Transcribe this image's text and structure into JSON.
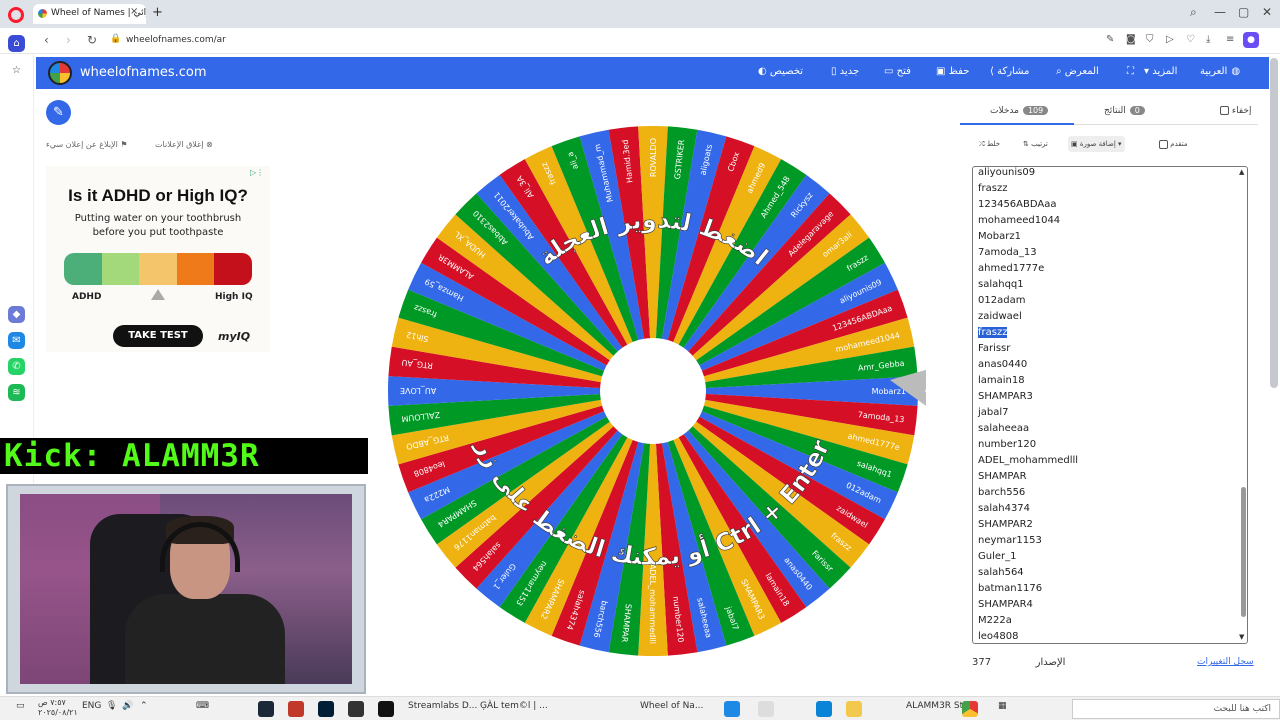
{
  "browser": {
    "tab_title": "Wheel of Names | عشوائي",
    "tab_close": "×",
    "new_tab": "+",
    "url": "wheelofnames.com/ar",
    "window_controls": [
      "—",
      "▢",
      "✕"
    ]
  },
  "site": {
    "name": "wheelofnames.com",
    "menu": [
      {
        "label": "العربية",
        "icon": "globe-icon"
      },
      {
        "label": "المزيد",
        "icon": "chevron-down-icon"
      },
      {
        "label": "",
        "icon": "fullscreen-icon"
      },
      {
        "label": "المعرض",
        "icon": "search-icon"
      },
      {
        "label": "مشاركة",
        "icon": "share-icon"
      },
      {
        "label": "حفظ",
        "icon": "save-icon"
      },
      {
        "label": "فتح",
        "icon": "folder-icon"
      },
      {
        "label": "جديد",
        "icon": "file-icon"
      },
      {
        "label": "تخصيص",
        "icon": "palette-icon"
      }
    ]
  },
  "left": {
    "report_ad": "الإبلاغ عن إعلان سيء",
    "close_ads": "إغلاق الإعلانات",
    "ad": {
      "title": "Is it ADHD or High IQ?",
      "subtitle": "Putting water on your toothbrush before you put toothpaste",
      "left_label": "ADHD",
      "right_label": "High IQ",
      "cta": "TAKE TEST",
      "brand": "myIQ",
      "bar_colors": [
        "#4caf7a",
        "#a3d97a",
        "#f4c56a",
        "#ee7a1a",
        "#c4101a"
      ]
    }
  },
  "stream": {
    "banner": "Kick: ALAMM3R"
  },
  "wheel": {
    "top_text": "اضغط لتدوير العجلة",
    "bottom_text": "أو يمكنك الضغط على زر Ctrl + Enter",
    "colors": [
      "#3369e8",
      "#d50f25",
      "#eeb211",
      "#009925"
    ],
    "segment_labels": [
      "Mobarz1",
      "7amoda_13",
      "ahmed1777e",
      "salahqq1",
      "012adam",
      "zaidwael",
      "fraszz",
      "Farissr",
      "anas0440",
      "lamain18",
      "SHAMPAR3",
      "jabal7",
      "salaheeaa",
      "number120",
      "ADEL_mohammedlll",
      "SHAMPAR",
      "barch556",
      "salah4374",
      "SHAMPAR2",
      "neymar1153",
      "Guler_1",
      "salah564",
      "batman1176",
      "SHAMPAR4",
      "M222a",
      "leo4808",
      "RTG_ABDO",
      "ZALLOUM",
      "AU_LOVE",
      "RTG_AU",
      "Slh12",
      "fraszz",
      "Hamza_59",
      "ALAMM3R",
      "HUDA_XL",
      "Abbas2310",
      "Abubaker2011",
      "Ali_3A",
      "fraszz",
      "ali_a",
      "Muhammad_m",
      "Hamid.3ed",
      "ROVALDO",
      "GSTRIKER",
      "aligoats",
      "Cbox",
      "ahmed9",
      "Ahmed_548",
      "Rickysz",
      "Adelegaravage",
      "omar3ali",
      "fraszz",
      "aliyounis09",
      "123456ABDAaa",
      "mohameed1044",
      "Amr_Gebba"
    ]
  },
  "panel": {
    "tab_entries": "مدخلات",
    "entries_count": "109",
    "tab_results": "النتائج",
    "results_count": "0",
    "hide_label": "إخفاء",
    "shuffle": "خلط",
    "sort": "ترتيب",
    "add_image": "إضافة صورة",
    "advanced": "متقدم",
    "entries": [
      "aliyounis09",
      "fraszz",
      "123456ABDAaa",
      "mohameed1044",
      "Mobarz1",
      "7amoda_13",
      "ahmed1777e",
      "salahqq1",
      "012adam",
      "zaidwael",
      "fraszz",
      "Farissr",
      "anas0440",
      "lamain18",
      "SHAMPAR3",
      "jabal7",
      "salaheeaa",
      "number120",
      "ADEL_mohammedlll",
      "SHAMPAR",
      "barch556",
      "salah4374",
      "SHAMPAR2",
      "neymar1153",
      "Guler_1",
      "salah564",
      "batman1176",
      "SHAMPAR4",
      "M222a",
      "leo4808"
    ],
    "selected_index": 10,
    "version_label": "الإصدار",
    "version": "377",
    "changelog": "سجل التغييرات"
  },
  "taskbar": {
    "time": "٧:٥٧ ص",
    "date": "٢٠٢٥/٠٨/٢١",
    "lang": "ENG",
    "apps": [
      "Streamlabs D...",
      "ĢÀL tem©l | ...",
      "Wheel of Na...",
      "ALAMM3R St..."
    ],
    "search_placeholder": "اكتب هنا للبحث"
  }
}
